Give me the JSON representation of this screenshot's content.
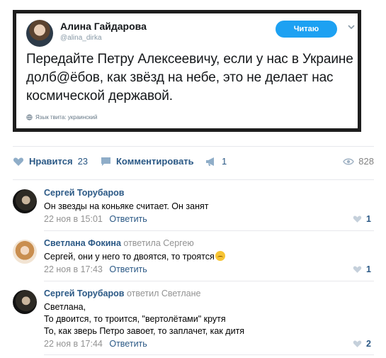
{
  "tweet": {
    "author_name": "Алина Гайдарова",
    "author_handle": "@alina_dirka",
    "follow_label": "Читаю",
    "text": "Передайте Петру Алексеевичу, если у нас в Украине долб@ёбов, как звёзд на небе, это не делает нас космической державой.",
    "language_note": "Язык твита: украинский"
  },
  "post_actions": {
    "like_label": "Нравится",
    "like_count": "23",
    "comment_label": "Комментировать",
    "share_count": "1",
    "views_count": "828"
  },
  "comments": [
    {
      "author": "Сергей Торубаров",
      "reply_to": "",
      "lines": [
        "Он звезды на коньяке считает. Он занят"
      ],
      "date": "22 ноя в 15:01",
      "reply_label": "Ответить",
      "likes": "1"
    },
    {
      "author": "Светлана Фокина",
      "reply_to": "ответила Сергею",
      "lines": [
        "Сергей, они у него то двоятся, то троятся"
      ],
      "date": "22 ноя в 17:43",
      "reply_label": "Ответить",
      "likes": "1"
    },
    {
      "author": "Сергей Торубаров",
      "reply_to": "ответил Светлане",
      "lines": [
        "Светлана,",
        "То двоится, то троится, \"вертолётами\" крутя",
        "То, как зверь Петро завоет, то заплачет, как дитя"
      ],
      "date": "22 ноя в 17:44",
      "reply_label": "Ответить",
      "likes": "2"
    }
  ],
  "colors": {
    "link": "#2a5885",
    "meta": "#939393",
    "twitter_blue": "#1da1f2"
  }
}
